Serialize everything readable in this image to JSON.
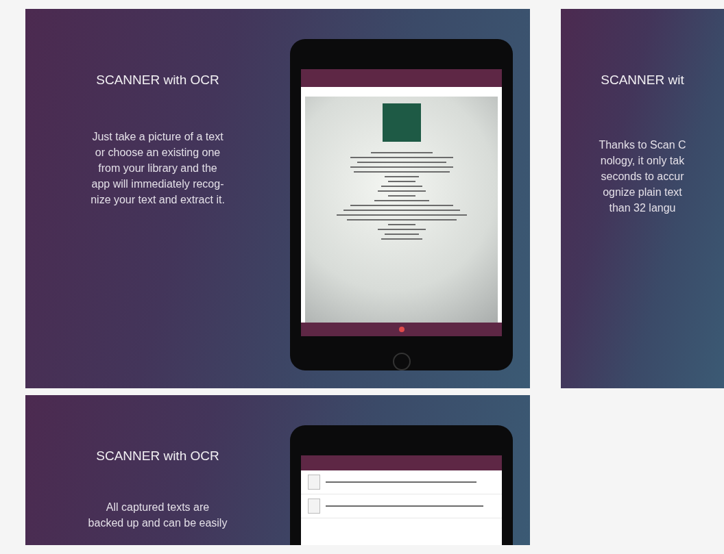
{
  "slides": [
    {
      "kind": "document",
      "title": "SCANNER with OCR",
      "body": [
        "Just take a picture of a text",
        "or choose an existing one",
        "from your library and the",
        "app will immediately recog-",
        "nize your text and extract it."
      ]
    },
    {
      "kind": "text_only",
      "title": "SCANNER wit",
      "body": [
        "Thanks to Scan C",
        "nology, it only tak",
        "seconds to accur",
        "ognize plain text",
        "than 32 langu"
      ]
    },
    {
      "kind": "list",
      "title": "SCANNER with OCR",
      "body": [
        "All captured texts are",
        "backed up and can be easily"
      ]
    }
  ]
}
